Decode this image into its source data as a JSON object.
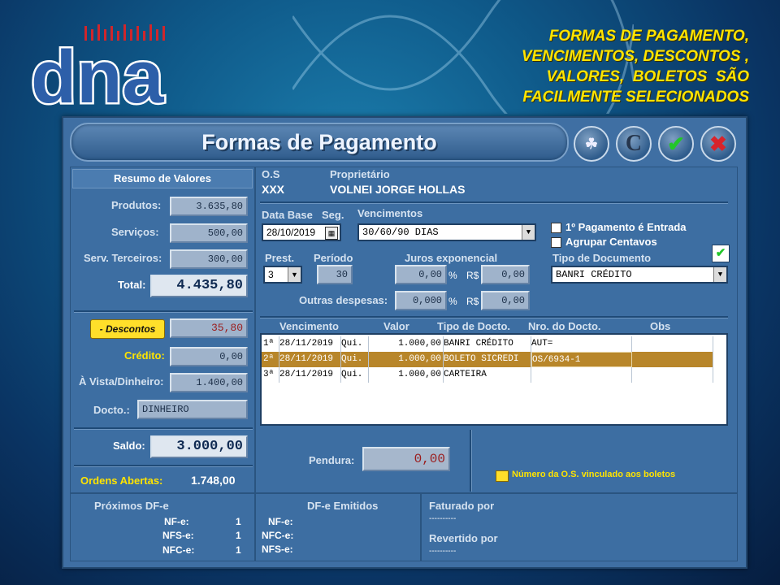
{
  "logo": {
    "text": "dna"
  },
  "promo": {
    "lines": [
      "FORMAS DE PAGAMENTO,",
      "VENCIMENTOS, DESCONTOS ,",
      "VALORES,  BOLETOS  SÃO",
      "FACILMENTE SELECIONADOS"
    ]
  },
  "window": {
    "title": "Formas de Pagamento"
  },
  "resumo": {
    "header": "Resumo de Valores",
    "produtos_label": "Produtos:",
    "produtos": "3.635,80",
    "servicos_label": "Serviços:",
    "servicos": "500,00",
    "terceiros_label": "Serv. Terceiros:",
    "terceiros": "300,00",
    "total_label": "Total:",
    "total": "4.435,80",
    "descontos_label": "- Descontos",
    "descontos": "35,80",
    "credito_label": "Crédito:",
    "credito": "0,00",
    "avista_label": "À Vista/Dinheiro:",
    "avista": "1.400,00",
    "docto_label": "Docto.:",
    "docto": "DINHEIRO",
    "saldo_label": "Saldo:",
    "saldo": "3.000,00",
    "ordens_label": "Ordens Abertas:",
    "ordens": "1.748,00"
  },
  "os": {
    "label": "O.S",
    "value": "XXX",
    "proprietario_label": "Proprietário",
    "proprietario": "VOLNEI JORGE HOLLAS"
  },
  "form": {
    "data_base_label": "Data Base",
    "seg_label": "Seg.",
    "data_base": "28/10/2019",
    "vencimentos_label": "Vencimentos",
    "vencimentos": "30/60/90 DIAS",
    "primeiro_pag_label": "1º Pagamento é Entrada",
    "agrupar_label": "Agrupar Centavos",
    "prest_label": "Prest.",
    "prest": "3",
    "periodo_label": "Período",
    "periodo": "30",
    "juros_label": "Juros exponencial",
    "juros_pct": "0,00",
    "pct_sym": "%",
    "rs_sym": "R$",
    "juros_rs": "0,00",
    "outras_label": "Outras despesas:",
    "outras_pct": "0,000",
    "outras_rs": "0,00",
    "tipo_doc_label": "Tipo de Documento",
    "tipo_doc": "BANRI CRÉDITO"
  },
  "grid": {
    "headers": [
      "Vencimento",
      "Valor",
      "Tipo de Docto.",
      "Nro. do Docto.",
      "Obs"
    ],
    "rows": [
      {
        "n": "1ª",
        "venc": "28/11/2019",
        "dia": "Qui.",
        "valor": "1.000,00",
        "tipo": "BANRI CRÉDITO",
        "nro": "AUT="
      },
      {
        "n": "2ª",
        "venc": "28/11/2019",
        "dia": "Qui.",
        "valor": "1.000,00",
        "tipo": "BOLETO SICREDI",
        "nro": "OS/6934-1"
      },
      {
        "n": "3ª",
        "venc": "28/11/2019",
        "dia": "Qui.",
        "valor": "1.000,00",
        "tipo": "CARTEIRA",
        "nro": ""
      }
    ]
  },
  "pendura": {
    "label": "Pendura:",
    "value": "0,00"
  },
  "note": {
    "text": "Número da O.S. vinculado aos boletos"
  },
  "footer": {
    "proximos_label": "Próximos DF-e",
    "nfe_label": "NF-e:",
    "nfe": "1",
    "nfse_label": "NFS-e:",
    "nfse": "1",
    "nfce_label": "NFC-e:",
    "nfce": "1",
    "emitidos_label": "DF-e Emitidos",
    "em_nfe": "NF-e:",
    "em_nfce": "NFC-e:",
    "em_nfse": "NFS-e:",
    "faturado_label": "Faturado por",
    "faturado": "----------",
    "revertido_label": "Revertido por",
    "revertido": "----------"
  },
  "colors": {
    "accent": "#ffe400",
    "selected_row": "#b8862a",
    "danger": "#9b1c1c"
  }
}
